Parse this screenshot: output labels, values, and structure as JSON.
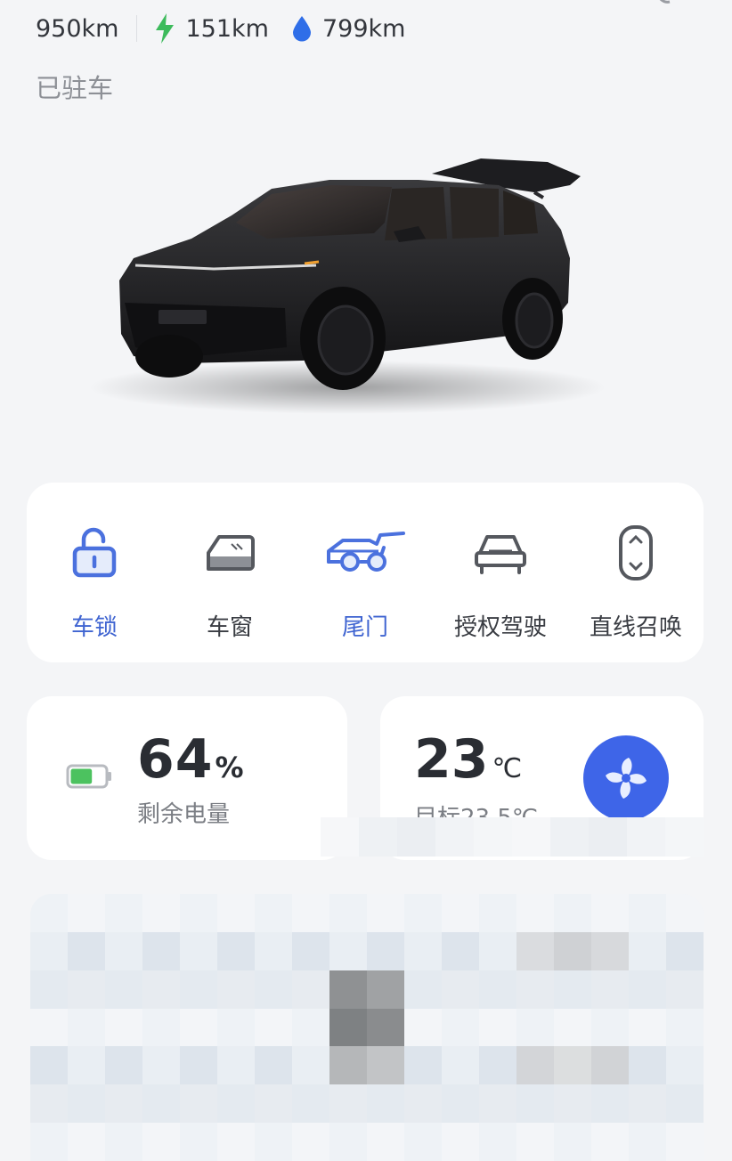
{
  "header": {
    "range_total": "950km",
    "electric_range": "151km",
    "fuel_range": "799km",
    "status": "已驻车"
  },
  "controls": [
    {
      "label": "车锁",
      "icon": "unlocked-padlock-icon",
      "active": true
    },
    {
      "label": "车窗",
      "icon": "car-window-icon",
      "active": false
    },
    {
      "label": "尾门",
      "icon": "tailgate-open-icon",
      "active": true
    },
    {
      "label": "授权驾驶",
      "icon": "car-front-icon",
      "active": false
    },
    {
      "label": "直线召唤",
      "icon": "summon-capsule-icon",
      "active": false
    }
  ],
  "battery": {
    "value": "64",
    "unit": "%",
    "label": "剩余电量",
    "level": 0.64
  },
  "climate": {
    "temperature": "23",
    "unit": "℃",
    "target": "目标23.5℃"
  },
  "colors": {
    "accent_blue": "#3f64d1",
    "fan_blue": "#3e65e8",
    "electric_green": "#3dbb5c",
    "fuel_blue": "#2f6ee8",
    "battery_green": "#4cc25f"
  }
}
